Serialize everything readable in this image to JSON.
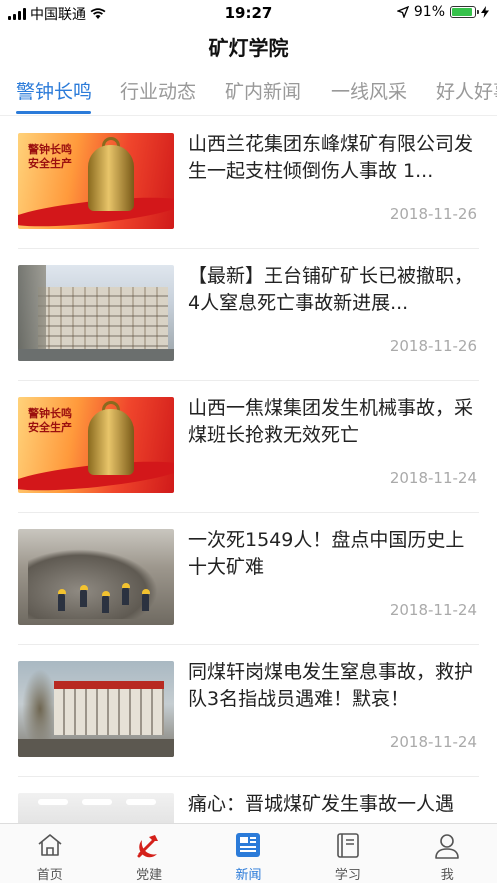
{
  "status_bar": {
    "carrier": "中国联通",
    "time": "19:27",
    "battery_percent": "91%",
    "battery_level": 0.91,
    "icons": [
      "signal-icon",
      "wifi-icon",
      "location-arrow-icon",
      "battery-icon",
      "charging-bolt-icon"
    ]
  },
  "header": {
    "title": "矿灯学院"
  },
  "tabs": [
    {
      "label": "警钟长鸣",
      "active": true
    },
    {
      "label": "行业动态",
      "active": false
    },
    {
      "label": "矿内新闻",
      "active": false
    },
    {
      "label": "一线风采",
      "active": false
    },
    {
      "label": "好人好事",
      "active": false
    }
  ],
  "news": [
    {
      "title": "山西兰花集团东峰煤矿有限公司发生一起支柱倾倒伤人事故 1...",
      "date": "2018-11-26",
      "thumb": "bell"
    },
    {
      "title": "【最新】王台铺矿矿长已被撤职，4人窒息死亡事故新进展...",
      "date": "2018-11-26",
      "thumb": "building"
    },
    {
      "title": "山西一焦煤集团发生机械事故，采煤班长抢救无效死亡",
      "date": "2018-11-24",
      "thumb": "bell"
    },
    {
      "title": "一次死1549人！盘点中国历史上十大矿难",
      "date": "2018-11-24",
      "thumb": "rubble"
    },
    {
      "title": "同煤轩岗煤电发生窒息事故，救护队3名指战员遇难！默哀！",
      "date": "2018-11-24",
      "thumb": "mine"
    },
    {
      "title": "痛心：晋城煤矿发生事故一人遇",
      "date": "",
      "thumb": "hall"
    }
  ],
  "bell_thumb_text": "警钟长鸣 安全生产",
  "tabbar": [
    {
      "label": "首页",
      "icon": "home-icon",
      "active": false
    },
    {
      "label": "党建",
      "icon": "party-emblem-icon",
      "active": false
    },
    {
      "label": "新闻",
      "icon": "news-icon",
      "active": true
    },
    {
      "label": "学习",
      "icon": "book-icon",
      "active": false
    },
    {
      "label": "我",
      "icon": "profile-icon",
      "active": false
    }
  ],
  "colors": {
    "accent": "#2b7bd9",
    "party_red": "#d4201a",
    "text": "#222222",
    "muted": "#aaaaaa"
  }
}
